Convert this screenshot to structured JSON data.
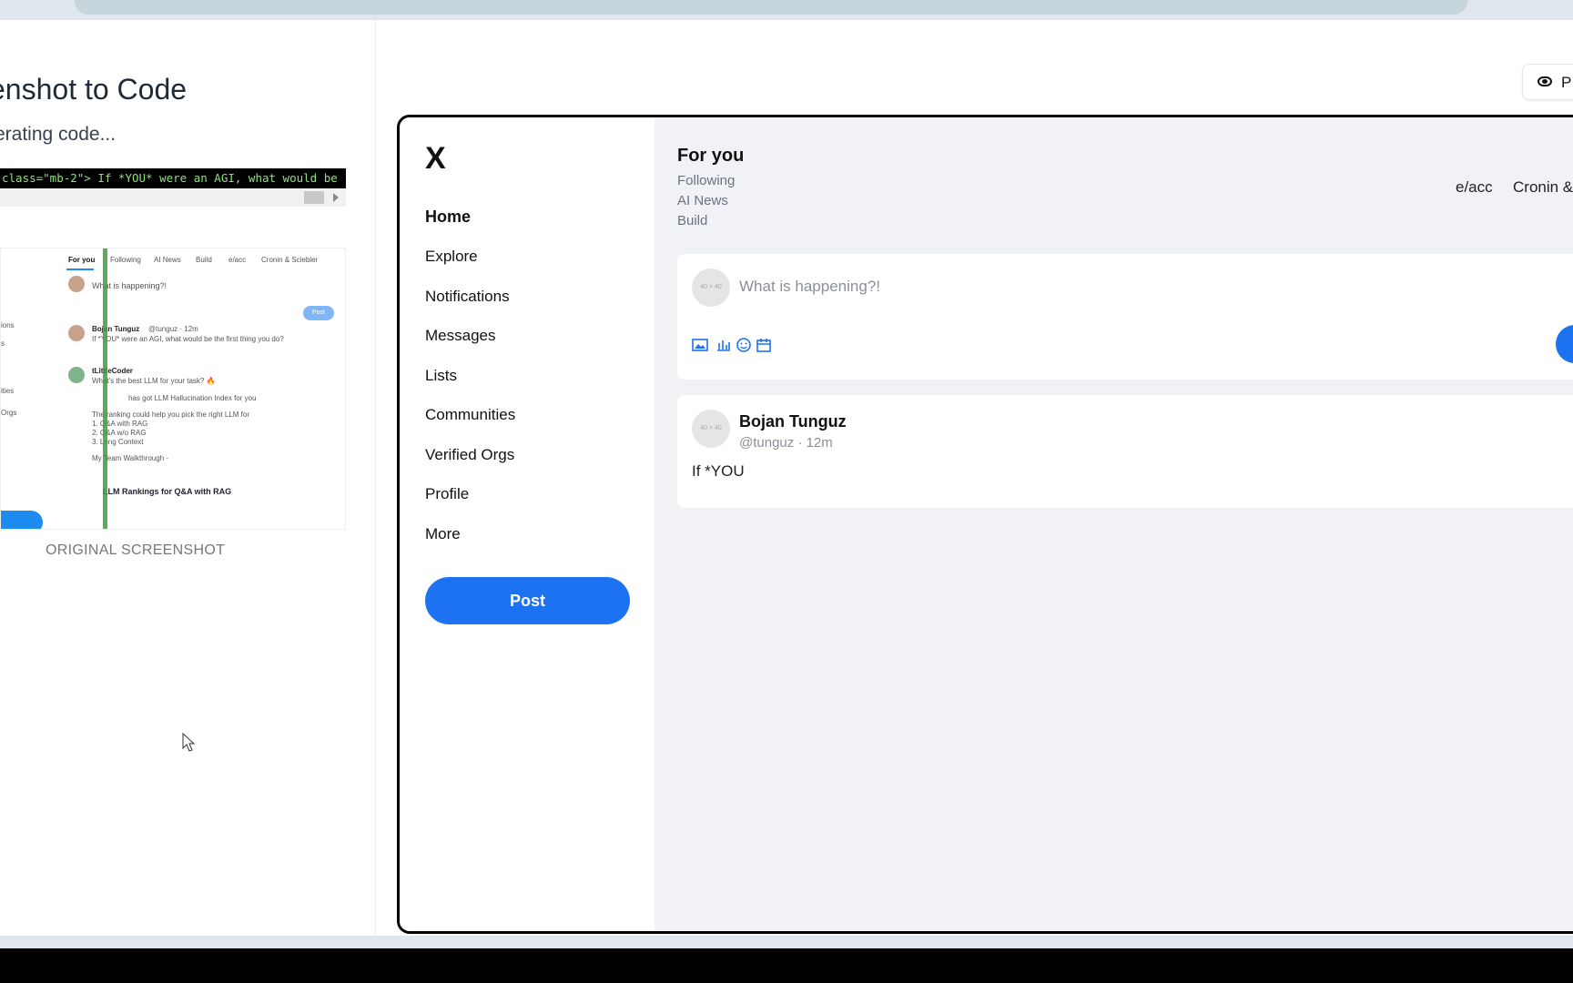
{
  "left_panel": {
    "title": "enshot to Code",
    "status": "erating code...",
    "code_snippet": " class=\"mb-2\"> If *YOU* were an AGI, what would be",
    "original_label": "ORIGINAL SCREENSHOT"
  },
  "thumbnail": {
    "tabs": [
      "For you",
      "Following",
      "AI News",
      "Build",
      "e/acc",
      "Cronin & Sciebler"
    ],
    "compose": "What is happening?!",
    "post": "Post",
    "tweet1_name": "Bojan Tunguz",
    "tweet1_handle": "@tunguz · 12m",
    "tweet1_text": "If *YOU* were an AGI, what would be the first thing you do?",
    "tweet2_name": "tLittleCoder",
    "tweet2_text": "What's the best LLM for your task? 🔥",
    "tweet2_line2": "has got LLM Hallucination Index for you",
    "tweet2_line3": "The ranking could help you pick the right LLM for",
    "tweet2_list": [
      "1. Q&A with RAG",
      "2. Q&A w/o RAG",
      "3. Long Context"
    ],
    "tweet2_line4": "My Team Walkthrough -",
    "card_title": "LLM Rankings for Q&A with RAG",
    "side": [
      "ions",
      "s",
      "ities",
      "Orgs"
    ]
  },
  "preview_button": {
    "label": "P"
  },
  "app": {
    "logo": "X",
    "nav": [
      "Home",
      "Explore",
      "Notifications",
      "Messages",
      "Lists",
      "Communities",
      "Verified Orgs",
      "Profile",
      "More"
    ],
    "post_button": "Post",
    "header": "For you",
    "tabs_left": [
      "Following",
      "AI News",
      "Build"
    ],
    "tabs_right": [
      "e/acc",
      "Cronin &"
    ],
    "compose_placeholder": "What is happening?!",
    "avatar_placeholder": "40 × 40",
    "tweet": {
      "name": "Bojan Tunguz",
      "handle": "@tunguz · 12m",
      "text": "If *YOU"
    }
  },
  "colors": {
    "accent": "#1d72f2",
    "feed_bg": "#f0f2f5"
  }
}
